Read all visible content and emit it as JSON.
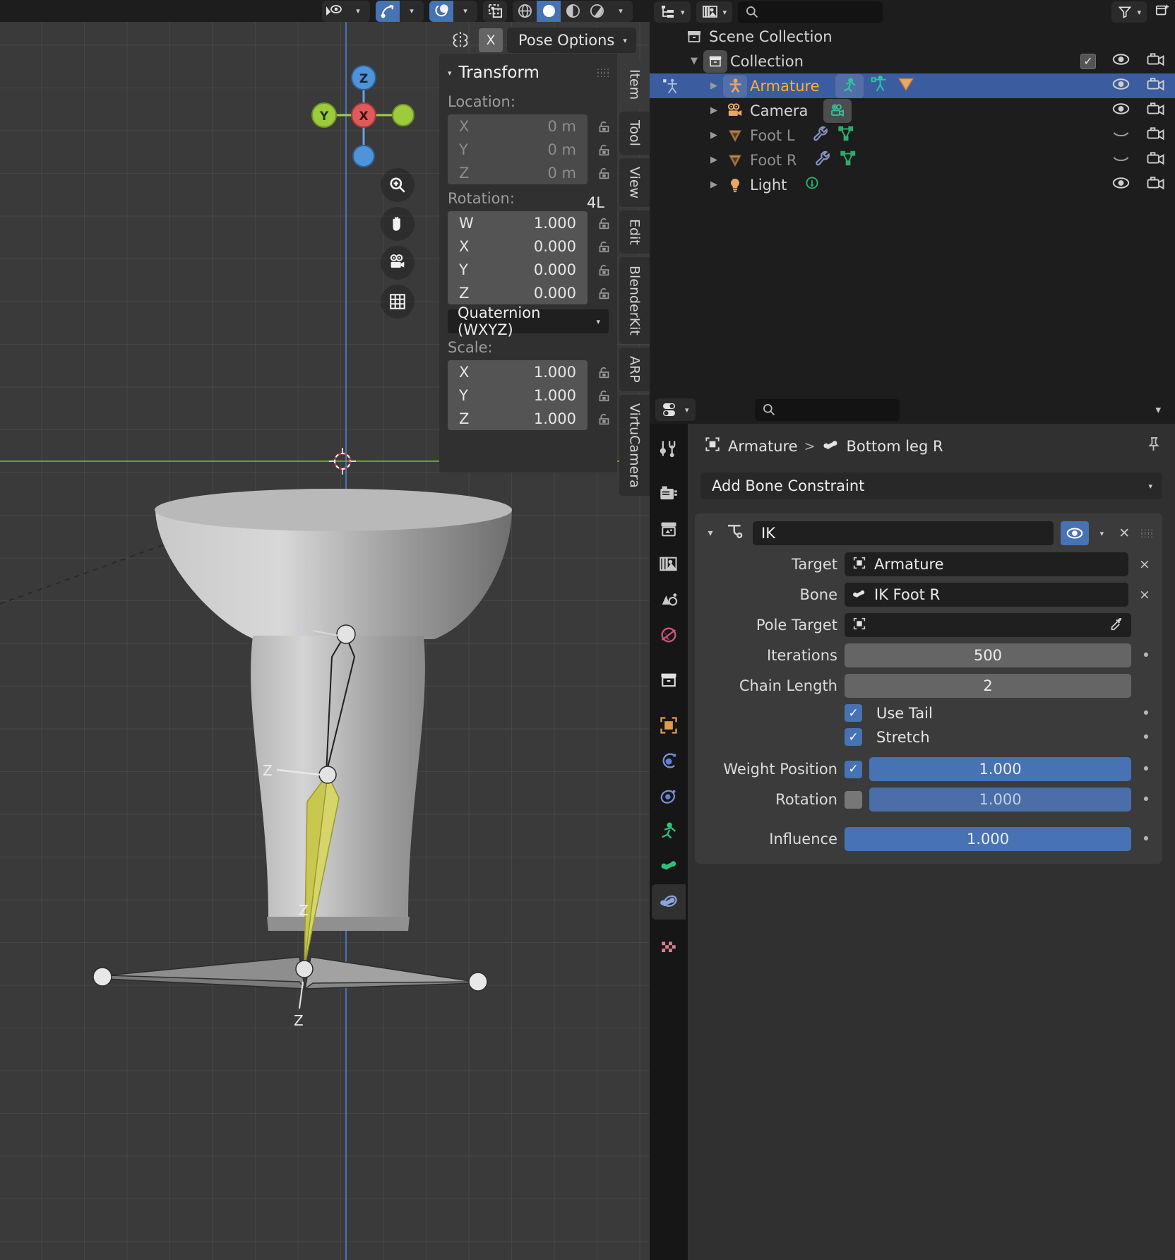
{
  "viewport": {
    "header_icons": [
      "select-visibility-icon",
      "snap-magnet-icon",
      "proportional-edit-icon",
      "overlay-toggle-icon",
      "wireframe-shading-icon",
      "solid-shading-icon",
      "material-preview-icon",
      "rendered-shading-icon"
    ],
    "mirror_label": "mirror-x-icon",
    "x_axis_label": "X",
    "pose_options_label": "Pose Options",
    "gizmo": {
      "z": "Z",
      "y": "Y",
      "x": "X"
    },
    "nav_icons": [
      "zoom-icon",
      "pan-hand-icon",
      "camera-view-icon",
      "grid-ortho-icon"
    ],
    "bone_labels": [
      "Z",
      "Z",
      "Z",
      "Z"
    ]
  },
  "sidebar": {
    "title": "Transform",
    "location_label": "Location:",
    "location": [
      {
        "axis": "X",
        "value": "0 m"
      },
      {
        "axis": "Y",
        "value": "0 m"
      },
      {
        "axis": "Z",
        "value": "0 m"
      }
    ],
    "rotation_label": "Rotation:",
    "rotation_mode_badge": "4L",
    "rotation": [
      {
        "axis": "W",
        "value": "1.000"
      },
      {
        "axis": "X",
        "value": "0.000"
      },
      {
        "axis": "Y",
        "value": "0.000"
      },
      {
        "axis": "Z",
        "value": "0.000"
      }
    ],
    "rotation_mode": "Quaternion (WXYZ)",
    "scale_label": "Scale:",
    "scale": [
      {
        "axis": "X",
        "value": "1.000"
      },
      {
        "axis": "Y",
        "value": "1.000"
      },
      {
        "axis": "Z",
        "value": "1.000"
      }
    ],
    "tabs": [
      {
        "label": "Item",
        "active": true
      },
      {
        "label": "Tool",
        "active": false
      },
      {
        "label": "View",
        "active": false
      },
      {
        "label": "Edit",
        "active": false
      },
      {
        "label": "BlenderKit",
        "active": false
      },
      {
        "label": "ARP",
        "active": false
      },
      {
        "label": "VirtuCamera",
        "active": false
      }
    ]
  },
  "outliner": {
    "display_mode_icon": "outliner-display-mode-icon",
    "filter_id_icon": "outliner-id-type-icon",
    "search_placeholder": "",
    "filter_icon": "funnel-filter-icon",
    "new_collection_icon": "new-collection-icon",
    "rows": [
      {
        "name": "Scene Collection",
        "icon": "scene-collection-icon",
        "indent": 0,
        "expand": "",
        "selected": false,
        "dim": false,
        "extra": [],
        "checkbox": false,
        "eye": false,
        "camera": false
      },
      {
        "name": "Collection",
        "icon": "collection-icon",
        "indent": 1,
        "expand": "down",
        "selected": false,
        "dim": false,
        "extra": [],
        "checkbox": true,
        "eye": true,
        "camera": true
      },
      {
        "name": "Armature",
        "icon": "armature-data-icon",
        "indent": 2,
        "expand": "right",
        "selected": true,
        "dim": false,
        "extra": [
          "pose-mode-icon",
          "armature-stick-icon",
          "mesh-triangle-icon"
        ],
        "checkbox": false,
        "eye": true,
        "camera": true
      },
      {
        "name": "Camera",
        "icon": "camera-object-icon",
        "indent": 2,
        "expand": "right",
        "selected": false,
        "dim": false,
        "extra": [
          "camera-data-icon"
        ],
        "checkbox": false,
        "eye": true,
        "camera": true
      },
      {
        "name": "Foot L",
        "icon": "mesh-object-icon",
        "indent": 2,
        "expand": "right",
        "selected": false,
        "dim": true,
        "extra": [
          "modifier-wrench-icon",
          "mesh-data-icon"
        ],
        "checkbox": false,
        "eye": "closed",
        "camera": true
      },
      {
        "name": "Foot R",
        "icon": "mesh-object-icon",
        "indent": 2,
        "expand": "right",
        "selected": false,
        "dim": true,
        "extra": [
          "modifier-wrench-icon",
          "mesh-data-icon"
        ],
        "checkbox": false,
        "eye": "closed",
        "camera": true
      },
      {
        "name": "Light",
        "icon": "light-object-icon",
        "indent": 2,
        "expand": "right",
        "selected": false,
        "dim": false,
        "extra": [
          "light-data-icon"
        ],
        "checkbox": false,
        "eye": true,
        "camera": true
      }
    ]
  },
  "properties": {
    "search_placeholder": "",
    "breadcrumb": {
      "object": "Armature",
      "separator": ">",
      "bone": "Bottom leg R"
    },
    "tabs": [
      "tool-properties-icon",
      "render-properties-icon",
      "output-properties-icon",
      "view-layer-properties-icon",
      "scene-properties-icon",
      "world-properties-icon",
      "collection-properties-icon",
      "object-properties-icon",
      "modifier-properties-icon",
      "physics-properties-icon",
      "object-constraint-properties-icon",
      "armature-data-properties-icon",
      "bone-properties-icon",
      "bone-constraint-properties-icon",
      "texture-properties-icon"
    ],
    "active_tab_index": 13,
    "add_constraint_label": "Add Bone Constraint",
    "constraint": {
      "icon": "ik-constraint-icon",
      "name": "IK",
      "enabled_icon": "eye-icon",
      "close_icon": "close-x-icon",
      "fields": [
        {
          "type": "object",
          "label": "Target",
          "value": "Armature",
          "icon": "object-icon",
          "clear": "×"
        },
        {
          "type": "bone",
          "label": "Bone",
          "value": "IK Foot R",
          "icon": "bone-icon",
          "clear": "×"
        },
        {
          "type": "object",
          "label": "Pole Target",
          "value": "",
          "icon": "object-icon",
          "clear": "eyedropper-icon"
        },
        {
          "type": "number",
          "label": "Iterations",
          "value": "500",
          "dot": true
        },
        {
          "type": "number",
          "label": "Chain Length",
          "value": "2",
          "dot": true
        },
        {
          "type": "checkbox",
          "label": "Use Tail",
          "checked": true,
          "dot": true
        },
        {
          "type": "checkbox",
          "label": "Stretch",
          "checked": true,
          "dot": true
        },
        {
          "type": "slider_cb",
          "label": "Weight Position",
          "checked": true,
          "value": "1.000",
          "dot": true,
          "enabled": true
        },
        {
          "type": "slider_cb",
          "label": "Rotation",
          "checked": false,
          "value": "1.000",
          "dot": true,
          "enabled": false
        },
        {
          "type": "slider",
          "label": "Influence",
          "value": "1.000",
          "dot": true
        }
      ]
    }
  },
  "colors": {
    "accent_blue": "#4772b3",
    "select_orange": "#ffaf29",
    "panel_bg": "#303030",
    "editor_bg": "#1d1d1d",
    "viewport_bg": "#3a3a3a",
    "bone_yellow": "#c8c850"
  }
}
